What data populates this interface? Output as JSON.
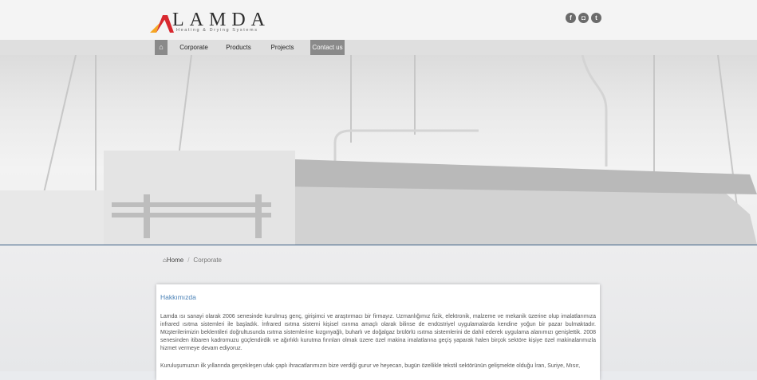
{
  "brand": {
    "name": "LAMDA",
    "tagline": "Heating & Drying Systems"
  },
  "social": [
    {
      "icon": "facebook-icon",
      "glyph": "f"
    },
    {
      "icon": "instagram-icon",
      "glyph": "◘"
    },
    {
      "icon": "twitter-icon",
      "glyph": "t"
    }
  ],
  "nav": {
    "home_glyph": "⌂",
    "items": [
      "Corporate",
      "Products",
      "Projects",
      "Contact us"
    ],
    "active": "Contact us"
  },
  "breadcrumb": {
    "home_glyph": "⌂",
    "home": "Home",
    "current": "Corporate"
  },
  "content": {
    "title": "Hakkımızda",
    "paragraph1": "Lamda ısı sanayi olarak 2006 senesinde kurulmuş genç, girişimci ve araştırmacı bir firmayız. Uzmanlığımız fizik, elektronik, malzeme ve mekanik üzerine olup imalatlarımıza infrared ısıtma sistemleri ile başladık. İnfrared ısıtma sistemi kişisel ısınma amaçlı olarak bilinse de endüstriyel uygulamalarda kendine yoğun bir pazar bulmaktadır. Müşterilerimizin beklentileri doğrultusunda ısıtma sistemlerine kızgınyağlı, buharlı ve doğalgaz brülörlü ısıtma sistemlerini de dahil ederek uygulama alanımızı genişlettik. 2008 senesinden itibaren kadromuzu güçlendirdik ve ağırlıklı kurutma fırınları olmak üzere özel makina imalatlarına geçiş yaparak halen birçok sektöre kişiye özel makinalarımızla hizmet vermeye devam ediyoruz.",
    "paragraph2": "Kuruluşumuzun ilk yıllarında gerçekleşen ufak çaplı ihracatlarımızın bize verdiği gurur ve heyecan, bugün özellikle tekstil sektörünün gelişmekte olduğu İran, Suriye, Mısır,"
  },
  "colors": {
    "accent": "#4b82b7",
    "logo_red": "#d8282f",
    "logo_orange": "#f5a623",
    "rule": "#3c5f86"
  }
}
